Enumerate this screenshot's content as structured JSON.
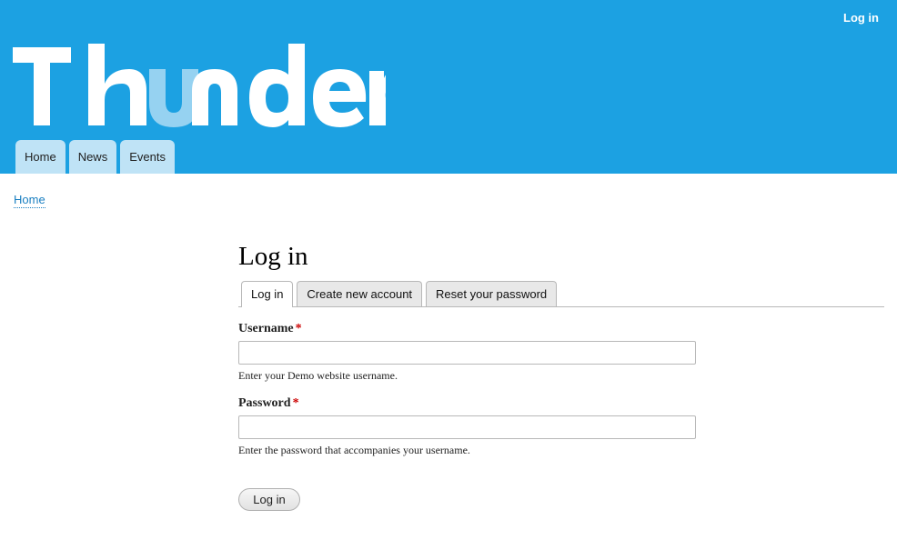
{
  "site": {
    "logo_text": "Thunder",
    "header_login_label": "Log in",
    "brand_color": "#1ca1e2",
    "nav": [
      {
        "label": "Home"
      },
      {
        "label": "News"
      },
      {
        "label": "Events"
      }
    ]
  },
  "breadcrumb": {
    "home_label": "Home"
  },
  "page": {
    "title": "Log in",
    "tabs": [
      {
        "label": "Log in",
        "active": true
      },
      {
        "label": "Create new account",
        "active": false
      },
      {
        "label": "Reset your password",
        "active": false
      }
    ]
  },
  "form": {
    "username": {
      "label": "Username",
      "required_marker": "*",
      "value": "",
      "description": "Enter your Demo website username."
    },
    "password": {
      "label": "Password",
      "required_marker": "*",
      "value": "",
      "description": "Enter the password that accompanies your username."
    },
    "submit_label": "Log in"
  },
  "icons": {
    "logo": "thunder-logo"
  }
}
